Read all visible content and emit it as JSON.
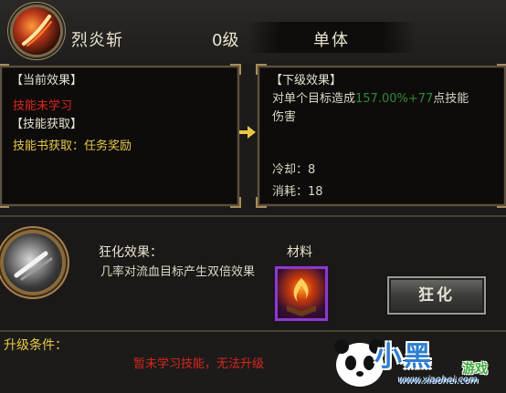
{
  "header": {
    "skill_name": "烈炎斩",
    "skill_level": "0级",
    "target_type": "单体"
  },
  "current_panel": {
    "title": "【当前效果】",
    "status": "技能未学习",
    "acquire_title": "【技能获取】",
    "acquire_text": "技能书获取：任务奖励"
  },
  "next_panel": {
    "title": "【下级效果】",
    "effect_prefix": "对单个目标造成",
    "effect_percent": "157.00%",
    "effect_plus": "+77",
    "effect_suffix": "点技能",
    "effect_line2": "伤害",
    "cooldown": "冷却：8",
    "cost": "消耗：18"
  },
  "frenzy": {
    "title": "狂化效果：",
    "description": "几率对流血目标产生双倍效果",
    "material_label": "材料",
    "button_label": "狂化"
  },
  "upgrade": {
    "label": "升级条件：",
    "message": "暂未学习技能，无法升级"
  },
  "watermark": {
    "brand": "小黑",
    "suffix": "游戏",
    "url": "www.xiaohei.com"
  },
  "colors": {
    "status_red": "#e0261e",
    "gold": "#e8c84a",
    "green_value": "#2e8a3a",
    "material_border": "#8a3cc8"
  },
  "icons": [
    "flame-slash-skill-icon",
    "arrow-right-icon",
    "blade-medal-icon",
    "fire-book-material-icon",
    "panda-logo-icon"
  ]
}
